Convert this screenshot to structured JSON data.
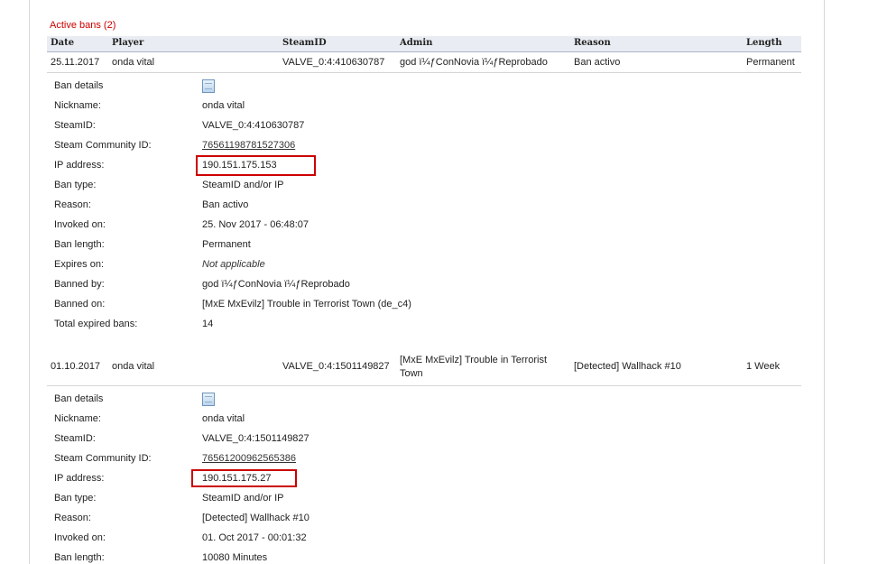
{
  "section_title": "Active bans (2)",
  "columns": [
    "Date",
    "Player",
    "SteamID",
    "Admin",
    "Reason",
    "Length"
  ],
  "bans": [
    {
      "date": "25.11.2017",
      "player": "onda vital",
      "steamid": "VALVE_0:4:410630787",
      "admin": "god ï¼ƒConNovia ï¼ƒReprobado",
      "reason": "Ban activo",
      "length": "Permanent",
      "details": {
        "ban_details": "Ban details",
        "nickname_label": "Nickname:",
        "nickname": "onda vital",
        "steamid_label": "SteamID:",
        "steamid": "VALVE_0:4:410630787",
        "community_label": "Steam Community ID:",
        "community_id": "76561198781527306",
        "ip_label": "IP address:",
        "ip": "190.151.175.153",
        "bantype_label": "Ban type:",
        "bantype": "SteamID and/or IP",
        "reason_label": "Reason:",
        "reason": "Ban activo",
        "invoked_label": "Invoked on:",
        "invoked": "25. Nov 2017 - 06:48:07",
        "length_label": "Ban length:",
        "length": "Permanent",
        "expires_label": "Expires on:",
        "expires": "Not applicable",
        "bannedby_label": "Banned by:",
        "bannedby": "god ï¼ƒConNovia ï¼ƒReprobado",
        "bannedon_label": "Banned on:",
        "bannedon": "[MxE MxEvilz] Trouble in Terrorist Town (de_c4)",
        "expired_label": "Total expired bans:",
        "expired": "14"
      }
    },
    {
      "date": "01.10.2017",
      "player": "onda vital",
      "steamid": "VALVE_0:4:1501149827",
      "admin": "[MxE MxEvilz] Trouble in Terrorist Town",
      "reason": "[Detected] Wallhack #10",
      "length": "1 Week",
      "details": {
        "ban_details": "Ban details",
        "nickname_label": "Nickname:",
        "nickname": "onda vital",
        "steamid_label": "SteamID:",
        "steamid": "VALVE_0:4:1501149827",
        "community_label": "Steam Community ID:",
        "community_id": "76561200962565386",
        "ip_label": "IP address:",
        "ip": "190.151.175.27",
        "bantype_label": "Ban type:",
        "bantype": "SteamID and/or IP",
        "reason_label": "Reason:",
        "reason": "[Detected] Wallhack #10",
        "invoked_label": "Invoked on:",
        "invoked": "01. Oct 2017 - 00:01:32",
        "length_label": "Ban length:",
        "length": "10080 Minutes"
      }
    }
  ],
  "colors": {
    "title": "#cc0000",
    "highlight": "#cc0000",
    "header_bg": "#e9ecf2"
  },
  "icons": {
    "details": "document-icon"
  }
}
